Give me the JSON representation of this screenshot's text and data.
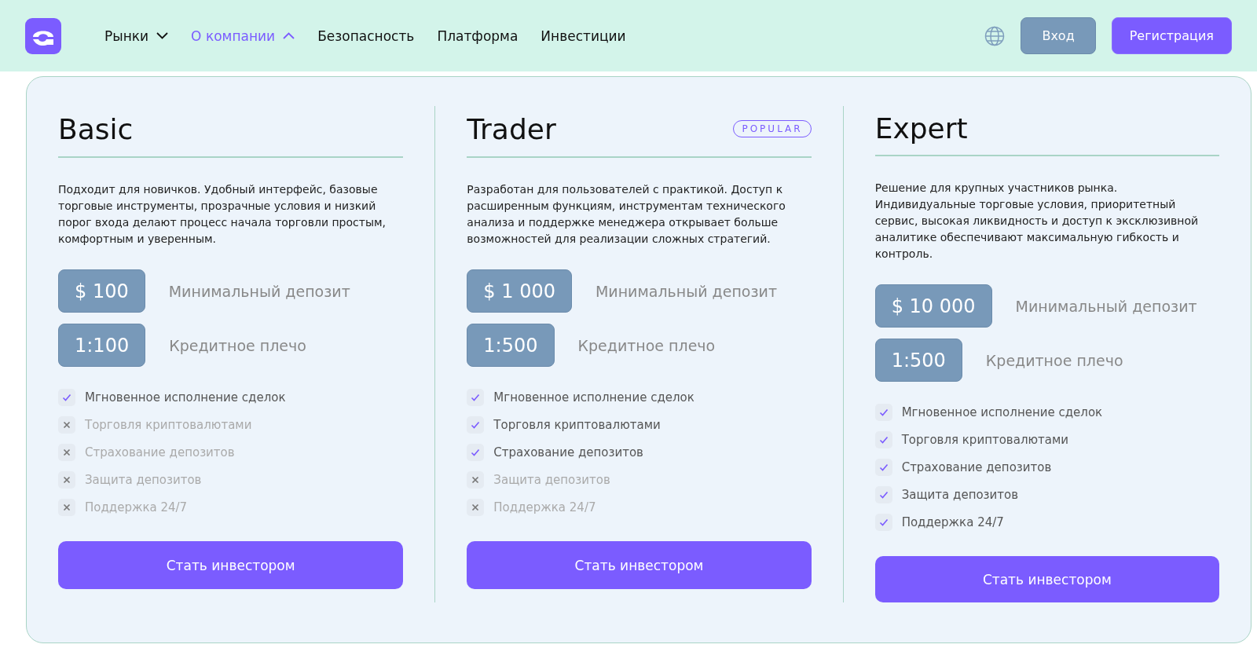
{
  "header": {
    "nav": [
      {
        "label": "Рынки",
        "selected": false,
        "expanded": false
      },
      {
        "label": "О компании",
        "selected": true,
        "expanded": true
      },
      {
        "label": "Безопасность",
        "selected": false
      },
      {
        "label": "Платформа",
        "selected": false
      },
      {
        "label": "Инвестиции",
        "selected": false
      }
    ],
    "buttons": [
      {
        "label": "Вход",
        "kind": "secondary"
      },
      {
        "label": "Регистрация",
        "kind": "primary"
      }
    ]
  },
  "plans": [
    {
      "name": "Basic",
      "description": "Подходит для новичков. Удобный интерфейс, базовые торговые инструменты, прозрачные условия и низкий порог входа делают процесс начала торговли простым, комфортным и уверенным.",
      "stats": [
        {
          "value": "$ 100",
          "label": "Минимальный депозит"
        },
        {
          "value": "1:100",
          "label": "Кредитное плечо"
        }
      ],
      "features": [
        {
          "label": "Мгновенное исполнение сделок",
          "included": true
        },
        {
          "label": "Торговля криптовалютами",
          "included": false
        },
        {
          "label": "Страхование депозитов",
          "included": false
        },
        {
          "label": "Защита депозитов",
          "included": false
        },
        {
          "label": "Поддержка 24/7",
          "included": false
        }
      ],
      "button": "Стать инвестором"
    },
    {
      "name": "Trader",
      "badge": "POPULAR",
      "description": "Разработан для пользователей с практикой. Доступ к расширенным функциям, инструментам технического анализа и поддержке менеджера открывает больше возможностей для реализации сложных стратегий.",
      "stats": [
        {
          "value": "$ 1 000",
          "label": "Минимальный депозит"
        },
        {
          "value": "1:500",
          "label": "Кредитное плечо"
        }
      ],
      "features": [
        {
          "label": "Мгновенное исполнение сделок",
          "included": true
        },
        {
          "label": "Торговля криптовалютами",
          "included": true
        },
        {
          "label": "Страхование депозитов",
          "included": true
        },
        {
          "label": "Защита депозитов",
          "included": false
        },
        {
          "label": "Поддержка 24/7",
          "included": false
        }
      ],
      "button": "Стать инвестором"
    },
    {
      "name": "Expert",
      "description": "Решение для крупных участников рынка. Индивидуальные торговые условия, приоритетный сервис, высокая ликвидность и доступ к эксклюзивной аналитике обеспечивают максимальную гибкость и контроль.",
      "stats": [
        {
          "value": "$ 10 000",
          "label": "Минимальный депозит"
        },
        {
          "value": "1:500",
          "label": "Кредитное плечо"
        }
      ],
      "features": [
        {
          "label": "Мгновенное исполнение сделок",
          "included": true
        },
        {
          "label": "Торговля криптовалютами",
          "included": true
        },
        {
          "label": "Страхование депозитов",
          "included": true
        },
        {
          "label": "Защита депозитов",
          "included": true
        },
        {
          "label": "Поддержка 24/7",
          "included": true
        }
      ],
      "button": "Стать инвестором"
    }
  ]
}
